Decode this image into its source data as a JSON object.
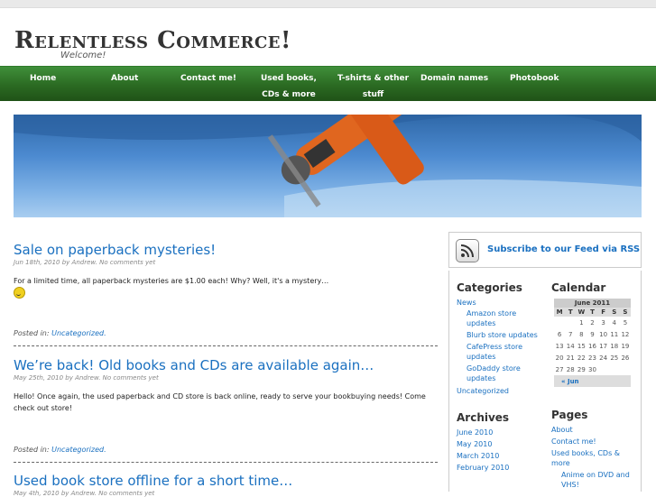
{
  "site": {
    "title": "Relentless Commerce!",
    "tagline": "Welcome!"
  },
  "nav": [
    "Home",
    "About",
    "Contact me!",
    "Used books,",
    "CDs & more",
    "T-shirts & other",
    "stuff",
    "Domain names",
    "Photobook"
  ],
  "posts": [
    {
      "title": "Sale on paperback mysteries!",
      "meta": "Jun 18th, 2010 by Andrew. No comments yet",
      "body": "For a limited time, all paperback mysteries are $1.00 each! Why? Well, it's a mystery…",
      "posted_label": "Posted in:",
      "category": "Uncategorized."
    },
    {
      "title": "We’re back! Old books and CDs are available again…",
      "meta": "May 25th, 2010 by Andrew. No comments yet",
      "body": "Hello! Once again, the used paperback and CD store is back online, ready to serve your bookbuying needs! Come check out store!",
      "posted_label": "Posted in:",
      "category": "Uncategorized."
    },
    {
      "title": "Used book store offline for a short time…",
      "meta": "May 4th, 2010 by Andrew. No comments yet"
    }
  ],
  "sidebar": {
    "rss": "Subscribe to our Feed via RSS",
    "categories_title": "Categories",
    "categories": [
      "News",
      "Amazon store",
      "updates",
      "Blurb store updates",
      "CafePress store",
      "updates",
      "GoDaddy store",
      "updates",
      "Uncategorized"
    ],
    "archives_title": "Archives",
    "archives": [
      "June 2010",
      "May 2010",
      "March 2010",
      "February 2010"
    ],
    "calendar_title": "Calendar",
    "calendar": {
      "caption": "June 2011",
      "days": [
        "M",
        "T",
        "W",
        "T",
        "F",
        "S",
        "S"
      ],
      "weeks": [
        [
          "",
          "",
          "1",
          "2",
          "3",
          "4",
          "5"
        ],
        [
          "6",
          "7",
          "8",
          "9",
          "10",
          "11",
          "12"
        ],
        [
          "13",
          "14",
          "15",
          "16",
          "17",
          "18",
          "19"
        ],
        [
          "20",
          "21",
          "22",
          "23",
          "24",
          "25",
          "26"
        ],
        [
          "27",
          "28",
          "29",
          "30",
          "",
          "",
          ""
        ]
      ],
      "prev": "« Jun"
    },
    "pages_title": "Pages",
    "pages": [
      "About",
      "Contact me!",
      "Used books, CDs &",
      "more",
      "Anime on DVD and",
      "VHS!"
    ]
  }
}
